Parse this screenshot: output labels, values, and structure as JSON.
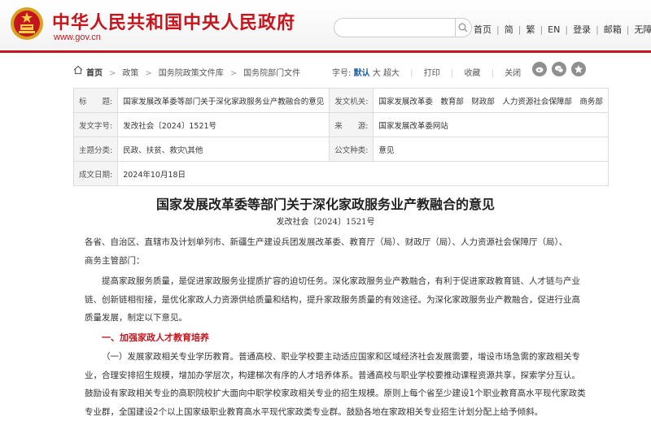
{
  "header": {
    "site_title": "中华人民共和国中央人民政府",
    "site_url": "www.gov.cn",
    "search_placeholder": "",
    "nav": [
      "首页",
      "简",
      "繁",
      "EN",
      "登录",
      "邮箱",
      "无障碍"
    ],
    "accent_color": "#c4161c"
  },
  "breadcrumb": {
    "items": [
      "首页",
      "政策",
      "国务院政策文件库",
      "国务院部门文件"
    ]
  },
  "tools": {
    "font_size_label": "字号:",
    "font_default": "默认",
    "font_large": "大",
    "font_xlarge": "超大",
    "print": "打印",
    "favorite": "收藏",
    "close": "关闭"
  },
  "share": [
    "weibo-icon",
    "wechat-icon",
    "qzone-icon"
  ],
  "info": {
    "title_key": "标　　题:",
    "title_val": "国家发展改革委等部门关于深化家政服务业产教融合的意见",
    "issuer_key": "发文机关:",
    "issuer_val": "国家发展改革委　教育部　财政部　人力资源社会保障部　商务部",
    "doc_no_key": "发文字号:",
    "doc_no_val": "发改社会〔2024〕1521号",
    "source_key": "来　　源:",
    "source_val": "国家发展改革委网站",
    "topic_key": "主题分类:",
    "topic_val": "民政、扶贫、救灾\\其他",
    "type_key": "公文种类:",
    "type_val": "意见",
    "date_key": "成文日期:",
    "date_val": "2024年10月18日"
  },
  "article": {
    "title": "国家发展改革委等部门关于深化家政服务业产教融合的意见",
    "number": "发改社会〔2024〕1521号",
    "recipients_line1": "各省、自治区、直辖市及计划单列市、新疆生产建设兵团发展改革委、教育厅（局）、财政厅（局）、人力资源社会保障厅（局）、",
    "recipients_line2": "商务主管部门：",
    "intro_line1": "提高家政服务质量，是促进家政服务业提质扩容的迫切任务。深化家政服务业产教融合，有利于促进家政教育链、人才链与产业",
    "intro_line2": "链、创新链相衔接，是优化家政人力资源供给质量和结构，提升家政服务质量的有效途径。为深化家政服务业产教融合，促进行业高",
    "intro_line3": "质量发展，制定以下意见。",
    "section1_heading": "一、加强家政人才教育培养",
    "s1_line1": "（一）发展家政相关专业学历教育。普通高校、职业学校要主动适应国家和区域经济社会发展需要，增设市场急需的家政相关专",
    "s1_line2": "业，合理安排招生规模，增加办学层次，构建梯次有序的人才培养体系。普通高校与职业学校要推动课程资源共享，探索学分互认。",
    "s1_line3": "鼓励设有家政相关专业的高职院校扩大面向中职学校家政相关专业的招生规模。原则上每个省至少建设1个职业教育高水平现代家政类",
    "s1_line4": "专业群，全国建设2个以上国家级职业教育高水平现代家政类专业群。鼓励各地在家政相关专业招生计划分配上给予倾斜。"
  }
}
